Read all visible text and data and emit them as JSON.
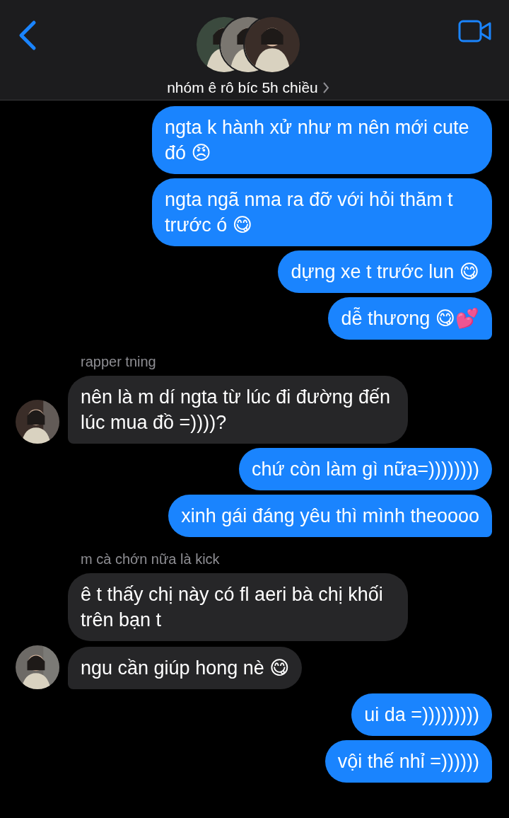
{
  "header": {
    "title": "nhóm ê rô bíc 5h chiều"
  },
  "messages": [
    {
      "kind": "sent",
      "text": "ngta k hành xử như m nên mới cute đó 😠",
      "tail": false
    },
    {
      "kind": "sent",
      "text": "ngta ngã nma ra đỡ với hỏi thăm t trước ó 😋",
      "tail": false
    },
    {
      "kind": "sent",
      "text": "dựng xe t trước lun 😋",
      "tail": false
    },
    {
      "kind": "sent",
      "text": "dễ thương 😋💕",
      "tail": true
    },
    {
      "kind": "sender",
      "text": "rapper tning"
    },
    {
      "kind": "received",
      "text": "nên là m dí ngta từ lúc đi đường đến lúc mua đồ =))))?",
      "tail": true,
      "avatar": true
    },
    {
      "kind": "sent",
      "text": "chứ còn làm gì nữa=))))))))",
      "tail": false
    },
    {
      "kind": "sent",
      "text": "xinh gái đáng yêu thì mình theoooo",
      "tail": true
    },
    {
      "kind": "sender",
      "text": "m cà chớn nữa là kick"
    },
    {
      "kind": "received",
      "text": "ê t thấy chị này có fl aeri bà chị khối trên bạn t",
      "tail": false,
      "avatar": false
    },
    {
      "kind": "received",
      "text": "ngu cần giúp hong nè 😋",
      "tail": true,
      "avatar": true
    },
    {
      "kind": "sent",
      "text": "ui da =)))))))))",
      "tail": false
    },
    {
      "kind": "sent",
      "text": "vội thế nhỉ =))))))",
      "tail": true
    }
  ]
}
